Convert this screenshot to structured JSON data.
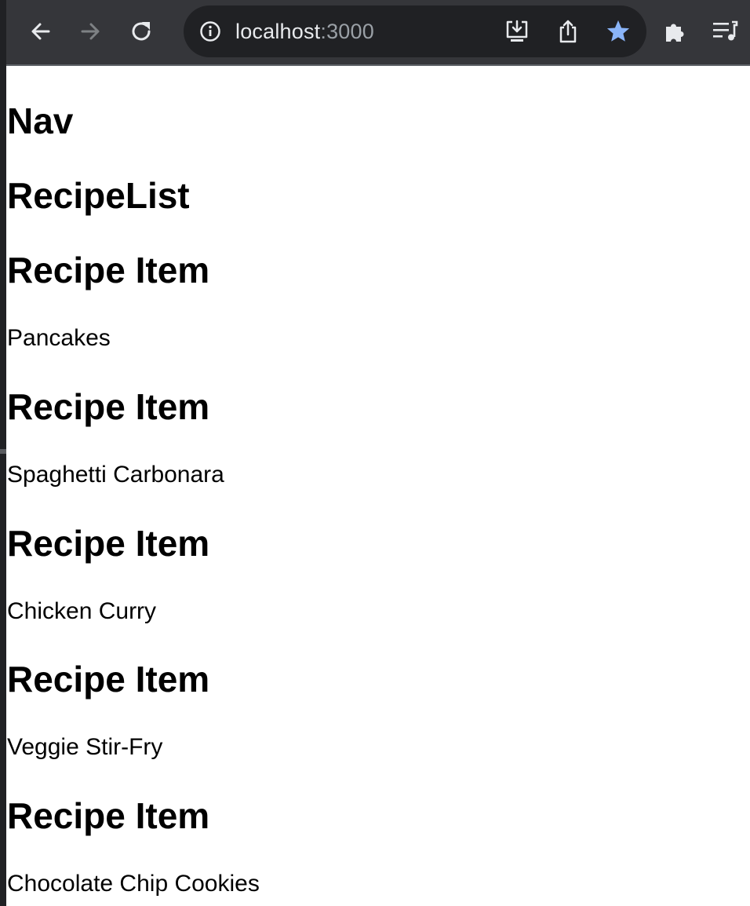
{
  "browser": {
    "url_host": "localhost",
    "url_port": ":3000",
    "star_color": "#8ab4f8",
    "icons": {
      "back": "arrow-left-icon",
      "forward": "arrow-right-icon",
      "reload": "reload-icon",
      "site_info": "info-circle-icon",
      "install": "install-app-icon",
      "share": "share-icon",
      "bookmark": "star-icon",
      "extensions": "puzzle-icon",
      "media": "media-queue-icon"
    }
  },
  "page": {
    "nav_heading": "Nav",
    "list_heading": "RecipeList",
    "recipes": [
      {
        "heading": "Recipe Item",
        "name": "Pancakes"
      },
      {
        "heading": "Recipe Item",
        "name": "Spaghetti Carbonara"
      },
      {
        "heading": "Recipe Item",
        "name": "Chicken Curry"
      },
      {
        "heading": "Recipe Item",
        "name": "Veggie Stir-Fry"
      },
      {
        "heading": "Recipe Item",
        "name": "Chocolate Chip Cookies"
      }
    ]
  }
}
